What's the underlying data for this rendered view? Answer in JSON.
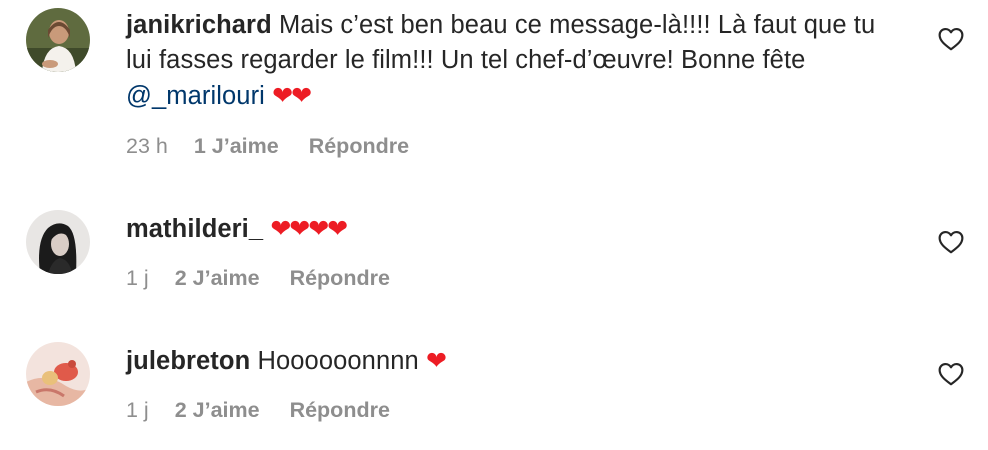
{
  "comments": [
    {
      "username": "janikrichard",
      "text": "Mais c’est ben beau ce message-là!!!! Là faut que tu lui fasses regarder le film!!! Un tel chef-d’œuvre! Bonne fête ",
      "mention": "@_marilouri",
      "emoji": "❤❤",
      "time": "23 h",
      "likes": "1 J’aime",
      "reply": "Répondre"
    },
    {
      "username": "mathilderi_",
      "text": "",
      "mention": "",
      "emoji": "❤❤❤❤",
      "time": "1 j",
      "likes": "2 J’aime",
      "reply": "Répondre"
    },
    {
      "username": "julebreton",
      "text": "Hoooooonnnn ",
      "mention": "",
      "emoji": "❤",
      "time": "1 j",
      "likes": "2 J’aime",
      "reply": "Répondre"
    }
  ],
  "colors": {
    "text": "#262626",
    "secondary": "#8e8e8e",
    "mention": "#00376b",
    "heart": "#ed1c24"
  },
  "icons": {
    "like": "heart-outline-icon",
    "avatar": "profile-photo"
  }
}
